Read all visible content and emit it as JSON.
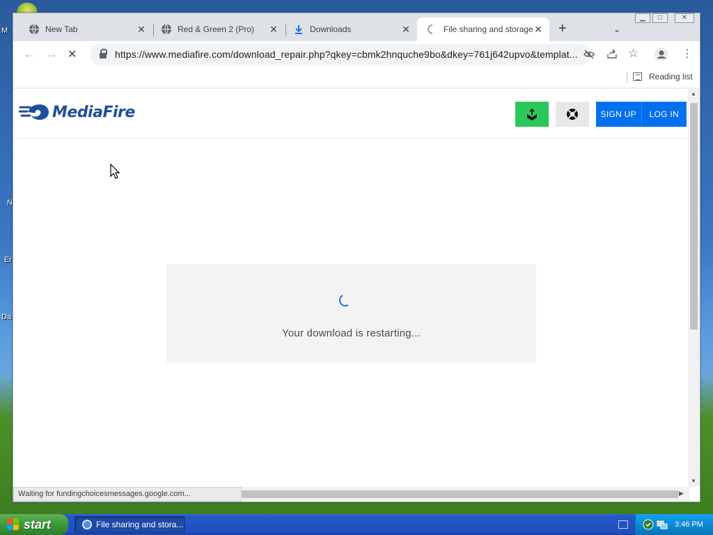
{
  "desktop": {
    "labels": [
      "M",
      "N",
      "Er",
      "Da"
    ]
  },
  "tabs": [
    {
      "title": "New Tab",
      "icon": "globe-icon",
      "active": false
    },
    {
      "title": "Red & Green 2 (Pro)",
      "icon": "globe-icon",
      "active": false
    },
    {
      "title": "Downloads",
      "icon": "download-icon",
      "active": false
    },
    {
      "title": "File sharing and storage m",
      "icon": "loading-icon",
      "active": true
    }
  ],
  "toolbar": {
    "url": "https://www.mediafire.com/download_repair.php?qkey=cbmk2hnquche9bo&dkey=761j642upvo&templat..."
  },
  "bookmarks": {
    "reading_list": "Reading list"
  },
  "site": {
    "logo_text": "MediaFire",
    "sign_up": "SIGN UP",
    "log_in": "LOG IN",
    "colors": {
      "upload": "#2ac85a",
      "support": "#e8e8e8",
      "auth": "#0070f0"
    }
  },
  "download": {
    "message": "Your download is restarting..."
  },
  "status_bar": {
    "text": "Waiting for fundingchoicesmessages.google.com..."
  },
  "taskbar": {
    "start_label": "start",
    "task_label": "File sharing and stora...",
    "clock": "3:46 PM"
  }
}
